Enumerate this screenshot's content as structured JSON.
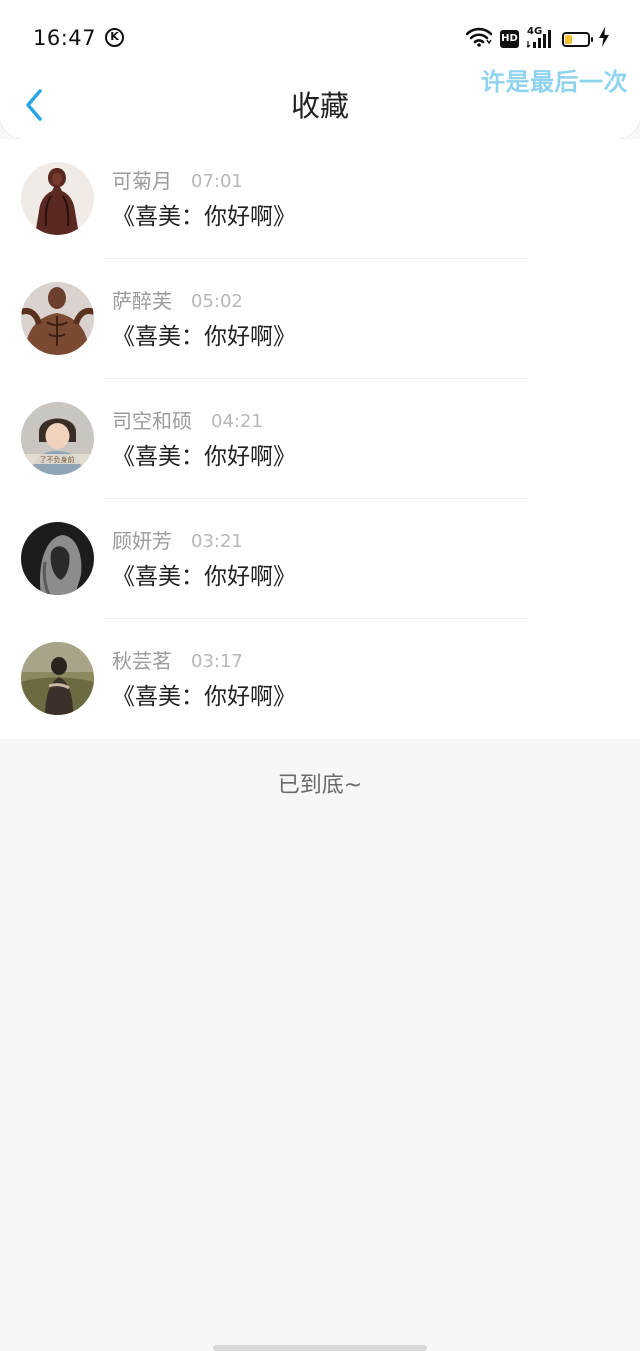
{
  "status_bar": {
    "time": "16:47",
    "k_badge": "K",
    "hd_badge": "HD",
    "network": "4G",
    "battery_level": 0.3,
    "icons": [
      "k-circle-icon",
      "wifi-icon",
      "hd-icon",
      "signal-4g-icon",
      "battery-icon",
      "charging-icon"
    ]
  },
  "floating_lyric": "许是最后一次",
  "nav": {
    "back_icon": "chevron-left-icon",
    "title": "收藏"
  },
  "favorites": [
    {
      "name": "可菊月",
      "time": "07:01",
      "message": "《喜美：你好啊》",
      "avatar": "statue-avatar"
    },
    {
      "name": "萨醉芙",
      "time": "05:02",
      "message": "《喜美：你好啊》",
      "avatar": "muscle-avatar"
    },
    {
      "name": "司空和硕",
      "time": "04:21",
      "message": "《喜美：你好啊》",
      "avatar": "girl-scarf-avatar"
    },
    {
      "name": "顾妍芳",
      "time": "03:21",
      "message": "《喜美：你好啊》",
      "avatar": "dark-hood-avatar"
    },
    {
      "name": "秋芸茗",
      "time": "03:17",
      "message": "《喜美：你好啊》",
      "avatar": "outdoor-avatar"
    }
  ],
  "end_text": "已到底~",
  "colors": {
    "accent": "#2aa5e6",
    "background": "#f8f7f8",
    "card": "#ffffff",
    "name_gray": "#9b9b9b",
    "lyric_blue": "#8fd3ef"
  }
}
